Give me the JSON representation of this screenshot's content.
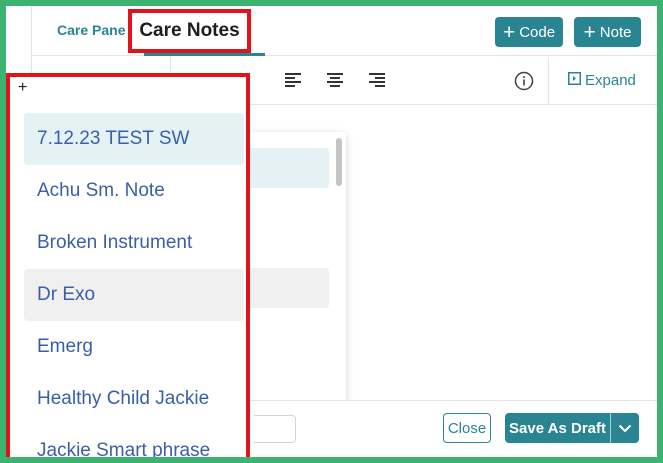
{
  "header": {
    "tab_panel": "Care Pane",
    "title": "Care Notes",
    "code_button": "Code",
    "note_button": "Note"
  },
  "toolbar": {
    "expand_label": "Expand",
    "icons": [
      "align-left-icon",
      "align-center-icon",
      "align-right-icon",
      "info-icon",
      "expand-icon"
    ]
  },
  "dropdown": {
    "items": [
      "7.12.23 TEST SW",
      "Achu Sm. Note",
      "Broken Instrument",
      "Dr Exo",
      "Emerg",
      "Healthy Child Jackie",
      "Jackie Smart phrase"
    ],
    "selected_index": 0,
    "hover_index": 3
  },
  "footer": {
    "close_button": "Close",
    "save_button": "Save As Draft"
  },
  "colors": {
    "accent": "#2a8592",
    "highlight_border": "#e0141c",
    "item_text": "#3a5fa8",
    "page_border": "#3cb371"
  }
}
